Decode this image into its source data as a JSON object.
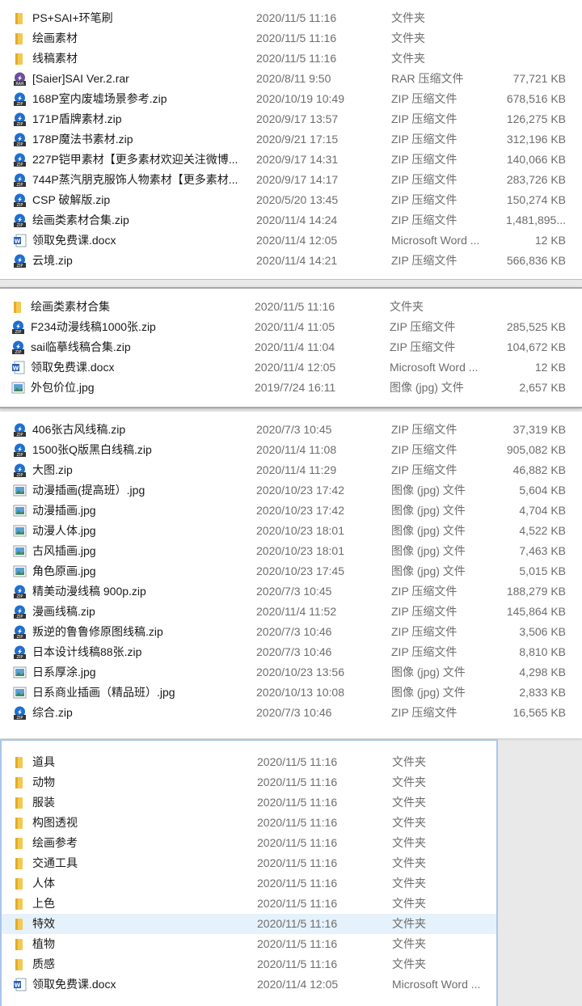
{
  "icon_colors": {
    "folder": "#f3c94f",
    "zip": "#1f6fd1",
    "rar": "#6b4fa0",
    "word": "#2b5fb8",
    "jpg": "#5aa0d8"
  },
  "panels": [
    {
      "rows": [
        {
          "icon": "folder",
          "name": "PS+SAI+环笔刷",
          "date": "2020/11/5 11:16",
          "type": "文件夹",
          "size": ""
        },
        {
          "icon": "folder",
          "name": "绘画素材",
          "date": "2020/11/5 11:16",
          "type": "文件夹",
          "size": ""
        },
        {
          "icon": "folder",
          "name": "线稿素材",
          "date": "2020/11/5 11:16",
          "type": "文件夹",
          "size": ""
        },
        {
          "icon": "rar",
          "name": "[Saier]SAI Ver.2.rar",
          "date": "2020/8/11 9:50",
          "type": "RAR 压缩文件",
          "size": "77,721 KB"
        },
        {
          "icon": "zip",
          "name": "168P室内废墟场景参考.zip",
          "date": "2020/10/19 10:49",
          "type": "ZIP 压缩文件",
          "size": "678,516 KB"
        },
        {
          "icon": "zip",
          "name": "171P盾牌素材.zip",
          "date": "2020/9/17 13:57",
          "type": "ZIP 压缩文件",
          "size": "126,275 KB"
        },
        {
          "icon": "zip",
          "name": "178P魔法书素材.zip",
          "date": "2020/9/21 17:15",
          "type": "ZIP 压缩文件",
          "size": "312,196 KB"
        },
        {
          "icon": "zip",
          "name": "227P铠甲素材【更多素材欢迎关注微博...",
          "date": "2020/9/17 14:31",
          "type": "ZIP 压缩文件",
          "size": "140,066 KB"
        },
        {
          "icon": "zip",
          "name": "744P蒸汽朋克服饰人物素材【更多素材...",
          "date": "2020/9/17 14:17",
          "type": "ZIP 压缩文件",
          "size": "283,726 KB"
        },
        {
          "icon": "zip",
          "name": "CSP 破解版.zip",
          "date": "2020/5/20 13:45",
          "type": "ZIP 压缩文件",
          "size": "150,274 KB"
        },
        {
          "icon": "zip",
          "name": "绘画类素材合集.zip",
          "date": "2020/11/4 14:24",
          "type": "ZIP 压缩文件",
          "size": "1,481,895..."
        },
        {
          "icon": "word",
          "name": "领取免费课.docx",
          "date": "2020/11/4 12:05",
          "type": "Microsoft Word ...",
          "size": "12 KB"
        },
        {
          "icon": "zip",
          "name": "云境.zip",
          "date": "2020/11/4 14:21",
          "type": "ZIP 压缩文件",
          "size": "566,836 KB"
        }
      ]
    },
    {
      "rows": [
        {
          "icon": "folder",
          "name": "绘画类素材合集",
          "date": "2020/11/5 11:16",
          "type": "文件夹",
          "size": ""
        },
        {
          "icon": "zip",
          "name": "F234动漫线稿1000张.zip",
          "date": "2020/11/4 11:05",
          "type": "ZIP 压缩文件",
          "size": "285,525 KB"
        },
        {
          "icon": "zip",
          "name": "sai临摹线稿合集.zip",
          "date": "2020/11/4 11:04",
          "type": "ZIP 压缩文件",
          "size": "104,672 KB"
        },
        {
          "icon": "word",
          "name": "领取免费课.docx",
          "date": "2020/11/4 12:05",
          "type": "Microsoft Word ...",
          "size": "12 KB"
        },
        {
          "icon": "jpg",
          "name": "外包价位.jpg",
          "date": "2019/7/24 16:11",
          "type": "图像 (jpg) 文件",
          "size": "2,657 KB"
        }
      ]
    },
    {
      "rows": [
        {
          "icon": "zip",
          "name": "406张古风线稿.zip",
          "date": "2020/7/3 10:45",
          "type": "ZIP 压缩文件",
          "size": "37,319 KB"
        },
        {
          "icon": "zip",
          "name": "1500张Q版黑白线稿.zip",
          "date": "2020/11/4 11:08",
          "type": "ZIP 压缩文件",
          "size": "905,082 KB"
        },
        {
          "icon": "zip",
          "name": "大图.zip",
          "date": "2020/11/4 11:29",
          "type": "ZIP 压缩文件",
          "size": "46,882 KB"
        },
        {
          "icon": "jpg",
          "name": "动漫插画(提高班）.jpg",
          "date": "2020/10/23 17:42",
          "type": "图像 (jpg) 文件",
          "size": "5,604 KB"
        },
        {
          "icon": "jpg",
          "name": "动漫插画.jpg",
          "date": "2020/10/23 17:42",
          "type": "图像 (jpg) 文件",
          "size": "4,704 KB"
        },
        {
          "icon": "jpg",
          "name": "动漫人体.jpg",
          "date": "2020/10/23 18:01",
          "type": "图像 (jpg) 文件",
          "size": "4,522 KB"
        },
        {
          "icon": "jpg",
          "name": "古风插画.jpg",
          "date": "2020/10/23 18:01",
          "type": "图像 (jpg) 文件",
          "size": "7,463 KB"
        },
        {
          "icon": "jpg",
          "name": "角色原画.jpg",
          "date": "2020/10/23 17:45",
          "type": "图像 (jpg) 文件",
          "size": "5,015 KB"
        },
        {
          "icon": "zip",
          "name": "精美动漫线稿 900p.zip",
          "date": "2020/7/3 10:45",
          "type": "ZIP 压缩文件",
          "size": "188,279 KB"
        },
        {
          "icon": "zip",
          "name": "漫画线稿.zip",
          "date": "2020/11/4 11:52",
          "type": "ZIP 压缩文件",
          "size": "145,864 KB"
        },
        {
          "icon": "zip",
          "name": "叛逆的鲁鲁修原图线稿.zip",
          "date": "2020/7/3 10:46",
          "type": "ZIP 压缩文件",
          "size": "3,506 KB"
        },
        {
          "icon": "zip",
          "name": "日本设计线稿88张.zip",
          "date": "2020/7/3 10:46",
          "type": "ZIP 压缩文件",
          "size": "8,810 KB"
        },
        {
          "icon": "jpg",
          "name": "日系厚涂.jpg",
          "date": "2020/10/23 13:56",
          "type": "图像 (jpg) 文件",
          "size": "4,298 KB"
        },
        {
          "icon": "jpg",
          "name": "日系商业插画（精品班）.jpg",
          "date": "2020/10/13 10:08",
          "type": "图像 (jpg) 文件",
          "size": "2,833 KB"
        },
        {
          "icon": "zip",
          "name": "综合.zip",
          "date": "2020/7/3 10:46",
          "type": "ZIP 压缩文件",
          "size": "16,565 KB"
        }
      ]
    },
    {
      "rows": [
        {
          "icon": "folder",
          "name": "道具",
          "date": "2020/11/5 11:16",
          "type": "文件夹",
          "size": ""
        },
        {
          "icon": "folder",
          "name": "动物",
          "date": "2020/11/5 11:16",
          "type": "文件夹",
          "size": ""
        },
        {
          "icon": "folder",
          "name": "服装",
          "date": "2020/11/5 11:16",
          "type": "文件夹",
          "size": ""
        },
        {
          "icon": "folder",
          "name": "构图透视",
          "date": "2020/11/5 11:16",
          "type": "文件夹",
          "size": ""
        },
        {
          "icon": "folder",
          "name": "绘画参考",
          "date": "2020/11/5 11:16",
          "type": "文件夹",
          "size": ""
        },
        {
          "icon": "folder",
          "name": "交通工具",
          "date": "2020/11/5 11:16",
          "type": "文件夹",
          "size": ""
        },
        {
          "icon": "folder",
          "name": "人体",
          "date": "2020/11/5 11:16",
          "type": "文件夹",
          "size": ""
        },
        {
          "icon": "folder",
          "name": "上色",
          "date": "2020/11/5 11:16",
          "type": "文件夹",
          "size": ""
        },
        {
          "icon": "folder",
          "name": "特效",
          "date": "2020/11/5 11:16",
          "type": "文件夹",
          "size": "",
          "selected": true
        },
        {
          "icon": "folder",
          "name": "植物",
          "date": "2020/11/5 11:16",
          "type": "文件夹",
          "size": ""
        },
        {
          "icon": "folder",
          "name": "质感",
          "date": "2020/11/5 11:16",
          "type": "文件夹",
          "size": ""
        },
        {
          "icon": "word",
          "name": "领取免费课.docx",
          "date": "2020/11/4 12:05",
          "type": "Microsoft Word ...",
          "size": ""
        }
      ]
    }
  ]
}
